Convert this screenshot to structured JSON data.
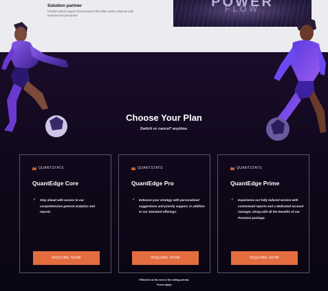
{
  "partner": {
    "title": "Solution partner",
    "description": "Uninterrupted support that produces fast after-sales solutions with experienced personnel"
  },
  "hero": {
    "title": "POWER",
    "subtitle": "FLOW"
  },
  "plans": {
    "title": "Choose Your Plan",
    "subtitle": "Switch or cancel* anytime.",
    "footnote": "*Effective at the end of the billing period.",
    "terms": "Terms apply",
    "cards": [
      {
        "logo": "QUANTSTATS",
        "name": "QuantEdge Core",
        "check": "✓",
        "description": "Stay ahead with access to our comprehensive general analytics and reports",
        "button": "INQUIRE NOW"
      },
      {
        "logo": "QUANTSTATS",
        "name": "QuantEdge Pro",
        "check": "✓",
        "description": "Enhance your strategy with personalised suggestions and priority support, in addition to our Standard offerings.",
        "button": "INQUIRE NOW"
      },
      {
        "logo": "QUANTSTATS",
        "name": "QuantEdge Prime",
        "check": "✓",
        "description": "Experience our fully tailored service with customised reports and a dedicated account manager, along with all the benefits of our Premium package.",
        "button": "INQUIRE NOW"
      }
    ]
  },
  "colors": {
    "accent": "#e36d3f",
    "background": "#140a1f",
    "card_border": "#5b5670"
  },
  "icons": {
    "logo_mark": "quantstats-logo-icon",
    "check": "check-icon"
  }
}
